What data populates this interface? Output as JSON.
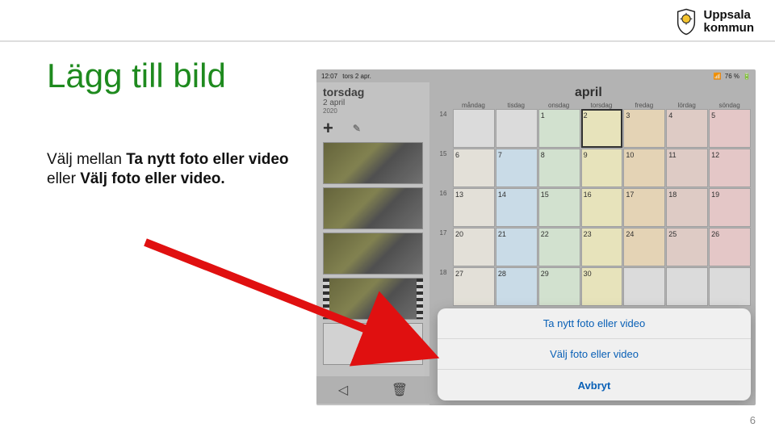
{
  "logo": {
    "line1": "Uppsala",
    "line2": "kommun"
  },
  "slide": {
    "title": "Lägg till bild",
    "body_prefix": "Välj mellan ",
    "body_bold1": "Ta nytt foto eller video",
    "body_mid": " eller ",
    "body_bold2": "Välj foto eller video.",
    "page_number": "6"
  },
  "status_bar": {
    "time": "12:07",
    "date": "tors 2 apr.",
    "battery": "76 %"
  },
  "day_panel": {
    "weekday": "torsdag",
    "date_line": "2 april",
    "year": "2020",
    "add_symbol": "+"
  },
  "calendar": {
    "month": "april",
    "weekdays": [
      "måndag",
      "tisdag",
      "onsdag",
      "torsdag",
      "fredag",
      "lördag",
      "söndag"
    ],
    "week_numbers": [
      "14",
      "15",
      "16",
      "17",
      "18"
    ],
    "rows": [
      [
        "",
        "",
        "1",
        "2",
        "3",
        "4",
        "5"
      ],
      [
        "6",
        "7",
        "8",
        "9",
        "10",
        "11",
        "12"
      ],
      [
        "13",
        "14",
        "15",
        "16",
        "17",
        "18",
        "19"
      ],
      [
        "20",
        "21",
        "22",
        "23",
        "24",
        "25",
        "26"
      ],
      [
        "27",
        "28",
        "29",
        "30",
        "",
        "",
        ""
      ]
    ],
    "today": "2"
  },
  "action_sheet": {
    "option1": "Ta nytt foto eller video",
    "option2": "Välj foto eller video",
    "cancel": "Avbryt"
  }
}
